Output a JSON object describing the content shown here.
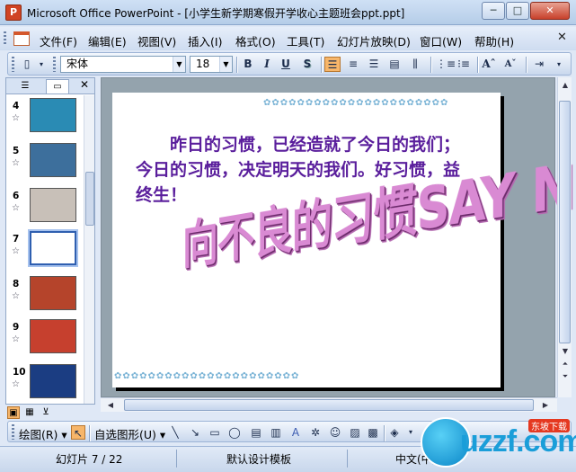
{
  "window": {
    "title": "Microsoft Office PowerPoint - [小学生新学期寒假开学收心主题班会ppt.ppt]",
    "min_glyph": "─",
    "max_glyph": "□",
    "close_glyph": "✕"
  },
  "menubar": {
    "items": [
      "文件(F)",
      "编辑(E)",
      "视图(V)",
      "插入(I)",
      "格式(O)",
      "工具(T)",
      "幻灯片放映(D)",
      "窗口(W)",
      "帮助(H)"
    ],
    "close_glyph": "✕"
  },
  "toolbar": {
    "font_name": "宋体",
    "font_size": "18",
    "bold": "B",
    "italic": "I",
    "underline": "U",
    "shadow": "S",
    "grow_font": "Aˆ",
    "shrink_font": "Aˇ"
  },
  "left_panel": {
    "close_glyph": "✕",
    "slides": [
      {
        "num": "4",
        "bg": "#2a8bb4"
      },
      {
        "num": "5",
        "bg": "#3d6f9c"
      },
      {
        "num": "6",
        "bg": "#c8c0b8"
      },
      {
        "num": "7",
        "bg": "#ffffff"
      },
      {
        "num": "8",
        "bg": "#b5442b"
      },
      {
        "num": "9",
        "bg": "#c6402e"
      },
      {
        "num": "10",
        "bg": "#1b3d82"
      }
    ],
    "selected": "7"
  },
  "slide": {
    "body_text": "昨日的习惯，已经造就了今日的我们；今日的习惯，决定明天的我们。好习惯，益终生！",
    "wordart": "向不良的习惯SAY NO ！",
    "border_pattern": "✿✿✿✿✿✿✿✿✿✿✿✿✿✿✿✿✿✿✿✿✿✿",
    "accent_color": "#5a1e9c"
  },
  "drawing_toolbar": {
    "draw_label": "绘图(R) ▾",
    "autoshapes_label": "自选图形(U) ▾"
  },
  "statusbar": {
    "slide_info": "幻灯片 7 / 22",
    "design": "默认设计模板",
    "language": "中文(中国)"
  },
  "watermark": {
    "text": "uzzf.com",
    "badge": "东坡下载"
  }
}
